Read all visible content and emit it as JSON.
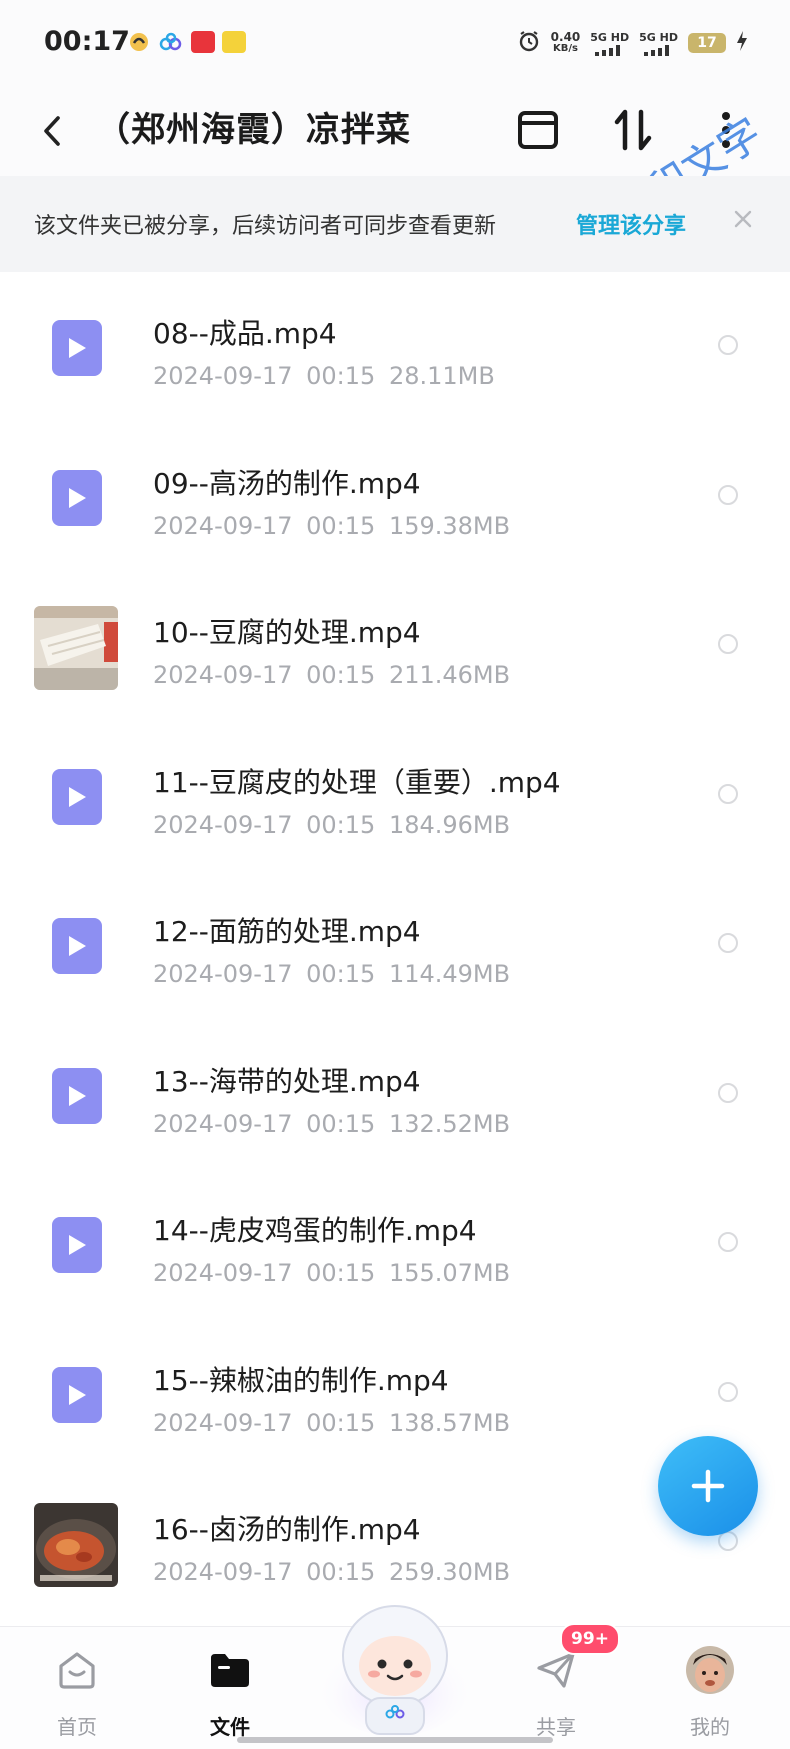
{
  "status_bar": {
    "time": "00:17",
    "net_speed_value": "0.40",
    "net_speed_unit": "KB/s",
    "signal_1": "5G HD",
    "signal_2": "5G HD",
    "battery": "17"
  },
  "header": {
    "title": "（郑州海霞）凉拌菜",
    "watermark": "水印文字"
  },
  "share_banner": {
    "text": "该文件夹已被分享，后续访问者可同步查看更新",
    "action": "管理该分享"
  },
  "files": [
    {
      "name": "08--成品.mp4",
      "date": "2024-09-17",
      "time": "00:15",
      "size": "28.11MB",
      "thumb": "video-icon"
    },
    {
      "name": "09--高汤的制作.mp4",
      "date": "2024-09-17",
      "time": "00:15",
      "size": "159.38MB",
      "thumb": "video-icon"
    },
    {
      "name": "10--豆腐的处理.mp4",
      "date": "2024-09-17",
      "time": "00:15",
      "size": "211.46MB",
      "thumb": "photo"
    },
    {
      "name": "11--豆腐皮的处理（重要）.mp4",
      "date": "2024-09-17",
      "time": "00:15",
      "size": "184.96MB",
      "thumb": "video-icon"
    },
    {
      "name": "12--面筋的处理.mp4",
      "date": "2024-09-17",
      "time": "00:15",
      "size": "114.49MB",
      "thumb": "video-icon"
    },
    {
      "name": "13--海带的处理.mp4",
      "date": "2024-09-17",
      "time": "00:15",
      "size": "132.52MB",
      "thumb": "video-icon"
    },
    {
      "name": "14--虎皮鸡蛋的制作.mp4",
      "date": "2024-09-17",
      "time": "00:15",
      "size": "155.07MB",
      "thumb": "video-icon"
    },
    {
      "name": "15--辣椒油的制作.mp4",
      "date": "2024-09-17",
      "time": "00:15",
      "size": "138.57MB",
      "thumb": "video-icon"
    },
    {
      "name": "16--卤汤的制作.mp4",
      "date": "2024-09-17",
      "time": "00:15",
      "size": "259.30MB",
      "thumb": "photo"
    }
  ],
  "bottom_nav": {
    "home": "首页",
    "files": "文件",
    "share": "共享",
    "share_badge": "99+",
    "me": "我的"
  },
  "colors": {
    "accent": "#1aa8d6",
    "video_icon": "#8d8ff2",
    "fab": "#2aa6f0",
    "badge": "#ff4d6d"
  }
}
